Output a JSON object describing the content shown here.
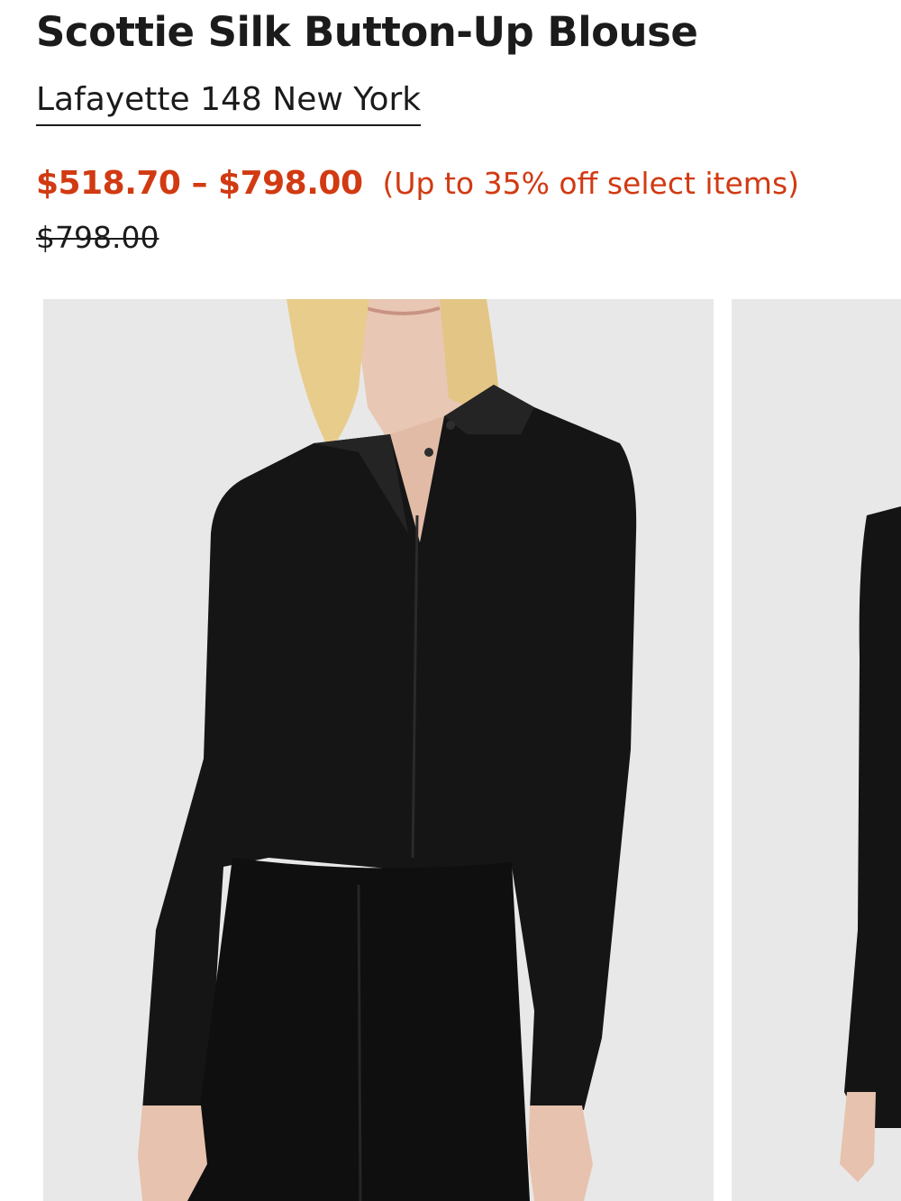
{
  "product": {
    "title": "Scottie Silk Button-Up Blouse",
    "brand": "Lafayette 148 New York"
  },
  "pricing": {
    "sale_range": "$518.70 – $798.00",
    "discount_note": "(Up to 35% off select items)",
    "original_price": "$798.00",
    "sale_color": "#d13a12"
  },
  "gallery": {
    "images": [
      {
        "name": "model-front-black-blouse",
        "current": true
      },
      {
        "name": "model-alternate-view",
        "current": false
      }
    ]
  }
}
